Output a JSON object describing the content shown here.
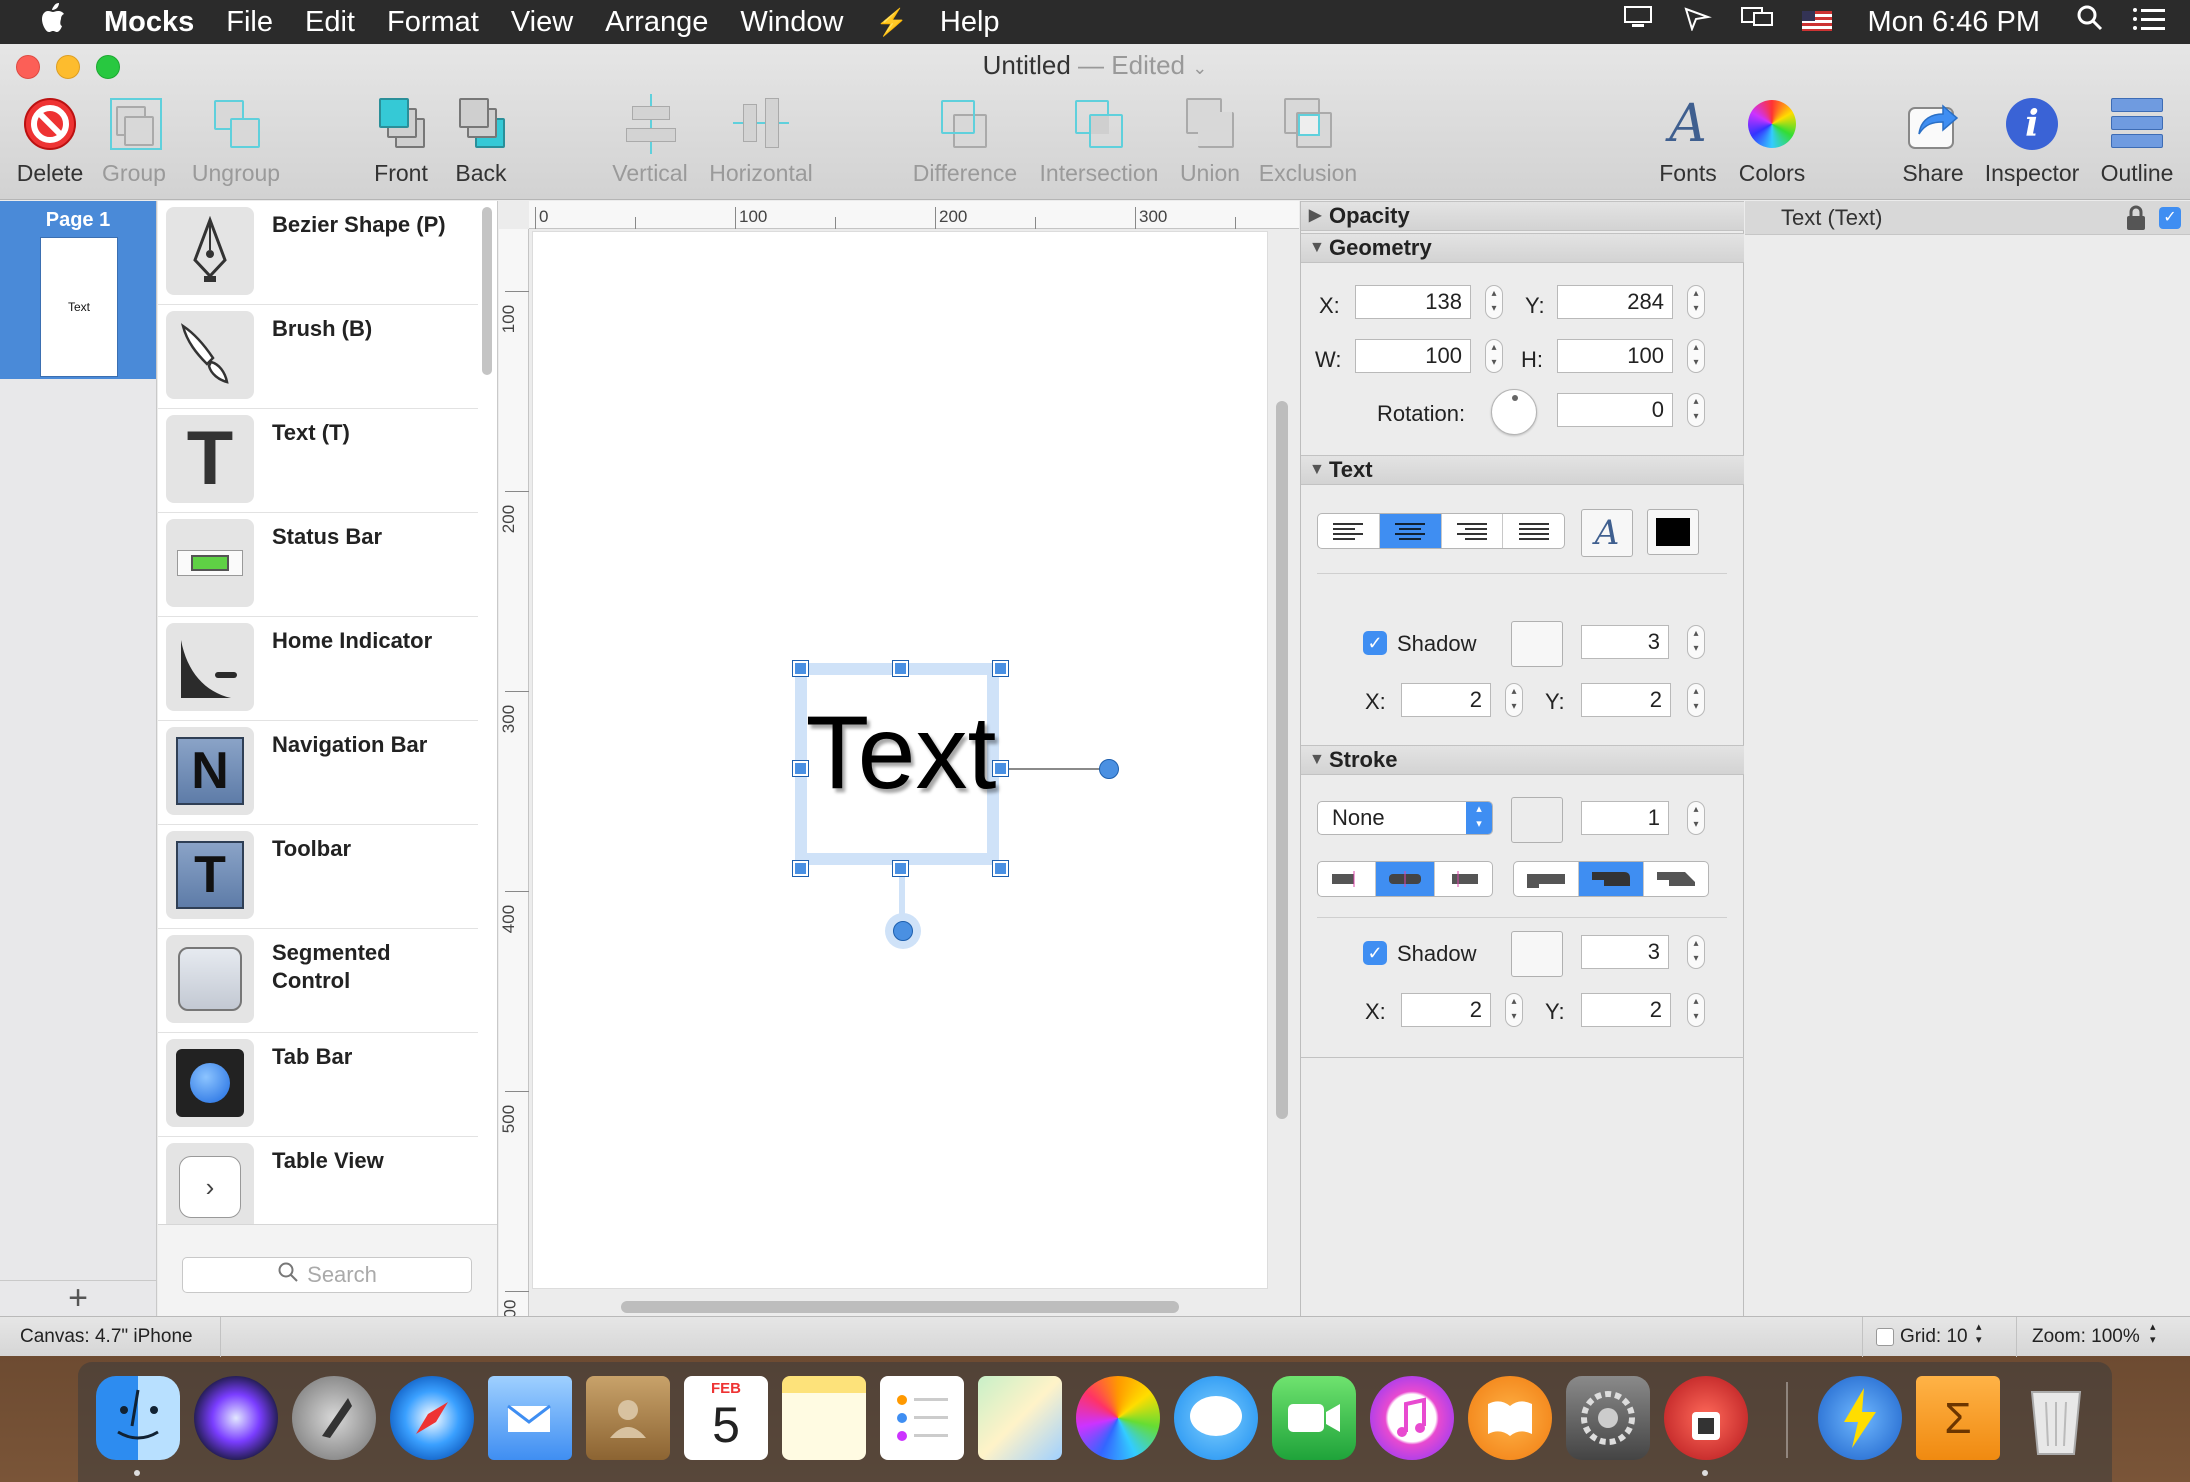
{
  "menubar": {
    "apple": "",
    "app_name": "Mocks",
    "items": [
      "File",
      "Edit",
      "Format",
      "View",
      "Arrange",
      "Window",
      "Help"
    ],
    "clock": "Mon 6:46 PM"
  },
  "window": {
    "title": "Untitled",
    "edited": "— Edited"
  },
  "toolbar": {
    "delete": "Delete",
    "group": "Group",
    "ungroup": "Ungroup",
    "front": "Front",
    "back": "Back",
    "vertical": "Vertical",
    "horizontal": "Horizontal",
    "difference": "Difference",
    "intersection": "Intersection",
    "union": "Union",
    "exclusion": "Exclusion",
    "fonts": "Fonts",
    "colors": "Colors",
    "share": "Share",
    "inspector": "Inspector",
    "outline": "Outline"
  },
  "pages": {
    "items": [
      {
        "label": "Page 1",
        "thumb_text": "Text"
      }
    ],
    "add": "+"
  },
  "library": {
    "items": [
      {
        "label": "Bezier Shape (P)",
        "icon": "pen-nib-icon"
      },
      {
        "label": "Brush (B)",
        "icon": "brush-icon"
      },
      {
        "label": "Text (T)",
        "icon": "text-T-icon"
      },
      {
        "label": "Status Bar",
        "icon": "battery-icon"
      },
      {
        "label": "Home Indicator",
        "icon": "home-indicator-icon"
      },
      {
        "label": "Navigation Bar",
        "icon": "navigation-bar-icon"
      },
      {
        "label": "Toolbar",
        "icon": "toolbar-icon"
      },
      {
        "label": "Segmented Control",
        "icon": "segmented-control-icon"
      },
      {
        "label": "Tab Bar",
        "icon": "tab-bar-icon"
      },
      {
        "label": "Table View",
        "icon": "chevron-right-icon"
      }
    ],
    "search_placeholder": "Search"
  },
  "rulers": {
    "h": [
      "0",
      "100",
      "200",
      "300"
    ],
    "v": [
      "100",
      "200",
      "300",
      "400",
      "500",
      "00"
    ]
  },
  "canvas": {
    "text_content": "Text"
  },
  "inspector": {
    "opacity_title": "Opacity",
    "geometry_title": "Geometry",
    "x_label": "X:",
    "x": "138",
    "y_label": "Y:",
    "y": "284",
    "w_label": "W:",
    "w": "100",
    "h_label": "H:",
    "h": "100",
    "rotation_label": "Rotation:",
    "rotation": "0",
    "text_title": "Text",
    "text_shadow_label": "Shadow",
    "text_shadow_blur": "3",
    "text_shadow_x_label": "X:",
    "text_shadow_x": "2",
    "text_shadow_y_label": "Y:",
    "text_shadow_y": "2",
    "stroke_title": "Stroke",
    "stroke_style": "None",
    "stroke_width": "1",
    "stroke_shadow_label": "Shadow",
    "stroke_shadow_blur": "3",
    "stroke_shadow_x_label": "X:",
    "stroke_shadow_x": "2",
    "stroke_shadow_y_label": "Y:",
    "stroke_shadow_y": "2"
  },
  "outline": {
    "item": "Text (Text)"
  },
  "status": {
    "canvas": "Canvas: 4.7\" iPhone",
    "grid": "Grid: 10",
    "zoom": "Zoom: 100%"
  },
  "dock": {
    "calendar_month": "FEB",
    "calendar_day": "5",
    "apps": [
      "Finder",
      "Siri",
      "Launchpad",
      "Safari",
      "Mail",
      "Contacts",
      "Calendar",
      "Notes",
      "Reminders",
      "Maps",
      "Photos",
      "Messages",
      "FaceTime",
      "iTunes",
      "iBooks",
      "System Preferences",
      "Mocks",
      "Reeder",
      "Soulver",
      "Trash"
    ]
  },
  "colors": {
    "accent": "#3f8ef2",
    "selected_page": "#4a8ad8",
    "menubar": "#2b2b2b"
  }
}
